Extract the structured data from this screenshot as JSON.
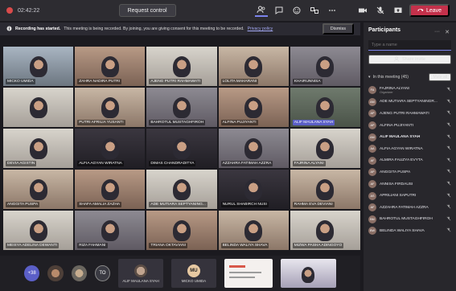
{
  "topbar": {
    "timer": "02:42:22",
    "request_control": "Request control",
    "leave": "Leave"
  },
  "banner": {
    "title": "Recording has started.",
    "text": "This meeting is being recorded. By joining, you are giving consent for this meeting to be recorded.",
    "link": "Privacy policy",
    "dismiss": "Dismiss"
  },
  "grid": {
    "tiles": [
      {
        "name": "MICKO UMIDA",
        "tone": "t-b"
      },
      {
        "name": "ZAHRA NADIRA PUTRI",
        "tone": "t-g"
      },
      {
        "name": "AJENG PUTRI RAHMAWATI",
        "tone": "t-e"
      },
      {
        "name": "LOLITA MAHARANI",
        "tone": "t-c"
      },
      {
        "name": "KHAIRUNNISA",
        "tone": "t-a"
      },
      {
        "name": "",
        "tone": "t-e"
      },
      {
        "name": "PUTRI AFRILIA YUSANTI",
        "tone": "t-c"
      },
      {
        "name": "BAHROTUL MUSTAGHFIROH",
        "tone": "t-a"
      },
      {
        "name": "ALFINA PUJIYANTI",
        "tone": "t-g"
      },
      {
        "name": "ALIF MAULANA SYAH",
        "tone": "t-f",
        "highlight": true
      },
      {
        "name": "DEVIA AGISTIN",
        "tone": "t-e"
      },
      {
        "name": "ALFIA AGYAN WIRATNA",
        "tone": "t-d"
      },
      {
        "name": "DIMAS CHANDRADITYA",
        "tone": "t-d"
      },
      {
        "name": "AZZAHRA FATIMAH AZZRA",
        "tone": "t-a"
      },
      {
        "name": "FAJRINA ALYANI",
        "tone": "t-e"
      },
      {
        "name": "ANGGITA PUSPA",
        "tone": "t-c"
      },
      {
        "name": "SHAFA AMALIA ZAZHA",
        "tone": "t-g"
      },
      {
        "name": "ADE MUTIARA SEPTYANING...",
        "tone": "t-e"
      },
      {
        "name": "NURUL SHABIRCH NUSI",
        "tone": "t-d"
      },
      {
        "name": "RAHMA EVA DEVIANI",
        "tone": "t-c"
      },
      {
        "name": "MEISYA ADELINA DEWANTI",
        "tone": "t-e"
      },
      {
        "name": "RIZA FAHMANI",
        "tone": "t-a"
      },
      {
        "name": "TRIANA OKTAVIANI",
        "tone": "t-g"
      },
      {
        "name": "BELINDA WALIYA SHAVA",
        "tone": "t-c"
      },
      {
        "name": "MIZWA PASHA ADINGOYO",
        "tone": "t-e"
      }
    ]
  },
  "bottom": {
    "more_count": "+38",
    "to_initials": "TO",
    "tile1_name": "ALIF MAULANA SYAH",
    "tile2_initials": "MU",
    "tile2_name": "MICKO UMIDA",
    "tile2_color": "#e7c9a2"
  },
  "panel": {
    "title": "Participants",
    "search_placeholder": "Type a name",
    "share_invite": "Share invite",
    "section_label": "In this meeting (45)",
    "mute_all": "Mute all",
    "participants": [
      {
        "name": "FAJRINA ALYANI",
        "role": "Organizer",
        "initials": "FA"
      },
      {
        "name": "ADE MUTIARA SEPTYANINGR...",
        "role": "",
        "initials": "AM"
      },
      {
        "name": "AJENG PUTRI RAHMAWATI",
        "role": "",
        "initials": "AP"
      },
      {
        "name": "ALFINA PUJIYANTI",
        "role": "",
        "initials": "AP"
      },
      {
        "name": "ALIF MAULANA SYAH",
        "role": "",
        "initials": "AM",
        "bold": true
      },
      {
        "name": "ALFIA AGYAN WIRATNA",
        "role": "",
        "initials": "AA"
      },
      {
        "name": "ALMIRA FAUZYA EVYTA",
        "role": "",
        "initials": "AF"
      },
      {
        "name": "ANGGITA PUSPA",
        "role": "",
        "initials": "AP"
      },
      {
        "name": "ANNISA FIRDAUSI",
        "role": "",
        "initials": "AF"
      },
      {
        "name": "APRILIANI SAPUTRI",
        "role": "",
        "initials": "AS"
      },
      {
        "name": "AZZAHRA FATIMAH AZZRA",
        "role": "",
        "initials": "AF"
      },
      {
        "name": "BAHROTUL MUSTAGHFIROH",
        "role": "",
        "initials": "BM"
      },
      {
        "name": "BELINDA WALIYA SHAVA",
        "role": "",
        "initials": "BW"
      }
    ]
  }
}
